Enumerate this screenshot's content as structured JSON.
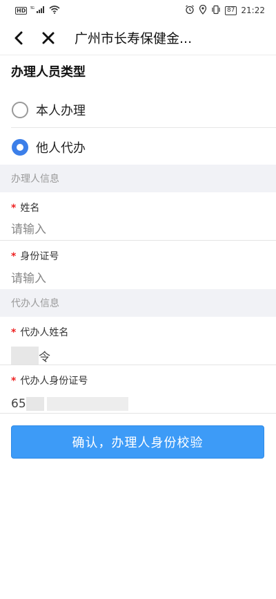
{
  "status_bar": {
    "hd": "HD",
    "network": "5G",
    "battery": "87",
    "time": "21:22"
  },
  "nav": {
    "title": "广州市长寿保健金..."
  },
  "handler_type": {
    "title": "办理人员类型",
    "options": [
      {
        "label": "本人办理",
        "selected": false
      },
      {
        "label": "他人代办",
        "selected": true
      }
    ]
  },
  "handler_info": {
    "header": "办理人信息",
    "name": {
      "label": "姓名",
      "placeholder": "请输入"
    },
    "id_number": {
      "label": "身份证号",
      "placeholder": "请输入"
    }
  },
  "agent_info": {
    "header": "代办人信息",
    "name": {
      "label": "代办人姓名",
      "visible_suffix": "令"
    },
    "id_number": {
      "label": "代办人身份证号",
      "visible_prefix": "65"
    }
  },
  "confirm_button": "确认，办理人身份校验",
  "colors": {
    "primary": "#3d9bf7",
    "radio_checked": "#3c7fe9",
    "required": "#e22222",
    "section_bg": "#f1f2f6"
  }
}
